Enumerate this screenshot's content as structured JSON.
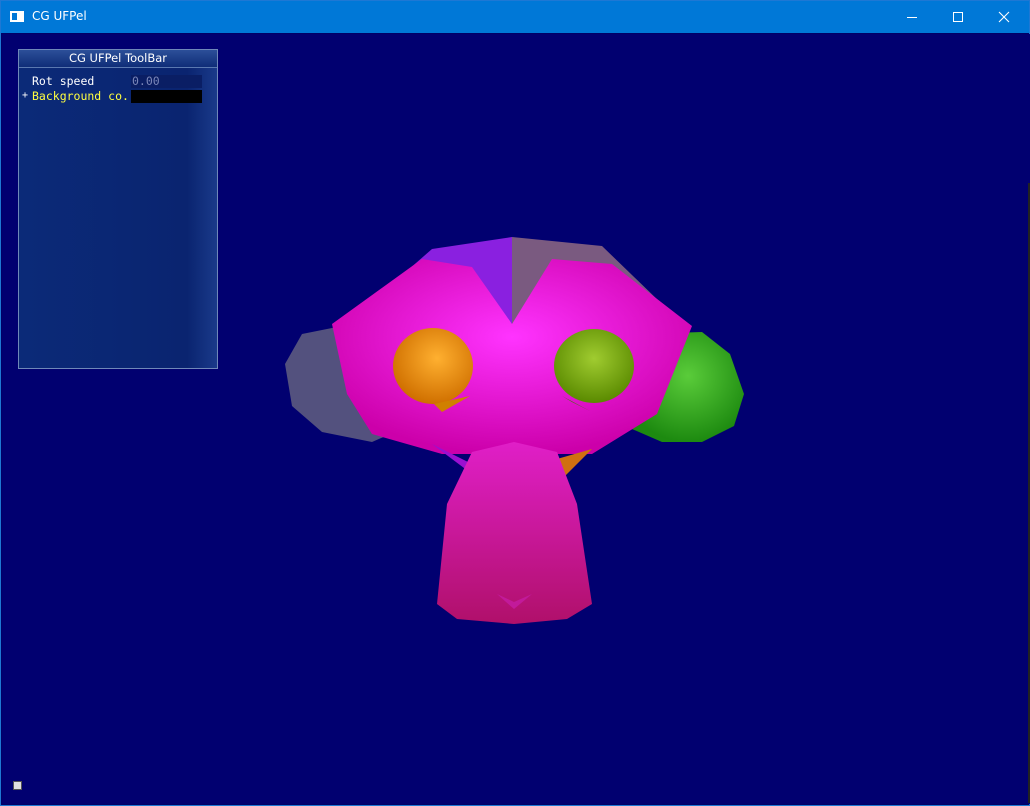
{
  "window": {
    "title": "CG UFPel",
    "icon": "app-window-icon"
  },
  "controls": {
    "minimize": "minimize-icon",
    "maximize": "maximize-icon",
    "close": "close-icon"
  },
  "colors": {
    "titlebar": "#0078d7",
    "viewport_background": "#010070",
    "swatch": "#000000"
  },
  "toolbar": {
    "title": "CG UFPel ToolBar",
    "rows": [
      {
        "label": "Rot speed",
        "value": "0.00"
      },
      {
        "label": "Background co..",
        "expander": "+",
        "value": ""
      }
    ]
  },
  "scene": {
    "object": "monkey-head-mesh"
  }
}
